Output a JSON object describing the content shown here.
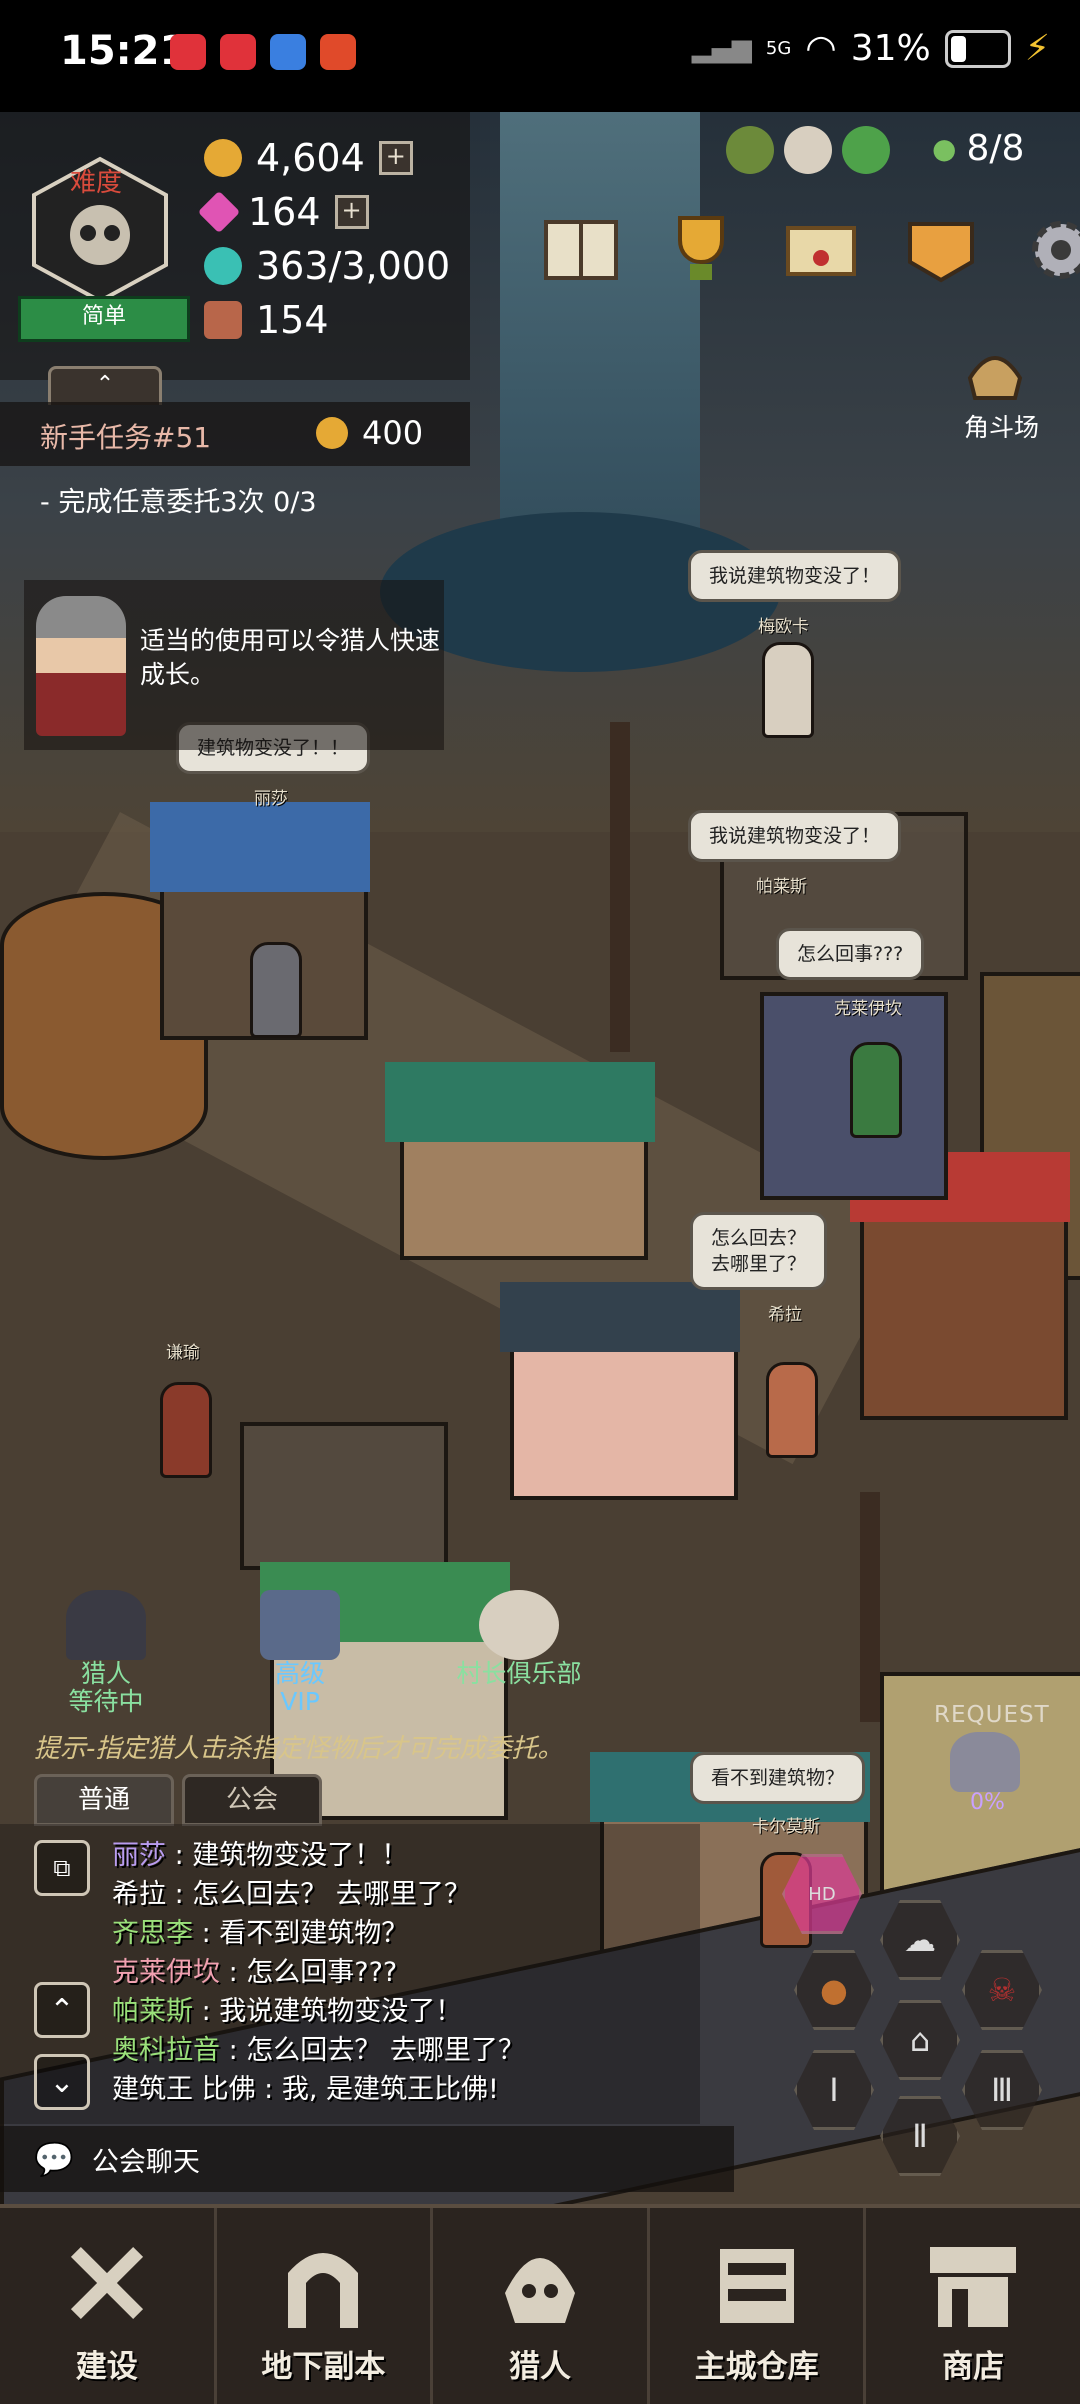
{
  "status_bar": {
    "time": "15:21",
    "network": "5G",
    "battery": "31%",
    "battery_level": 0.31
  },
  "hud": {
    "difficulty_label": "难度",
    "difficulty_value": "简单",
    "gold": "4,604",
    "gems": "164",
    "crystal": "363/3,000",
    "chests": "154",
    "population": "8/8",
    "arena_label": "角斗场",
    "icons": [
      "gift-icon",
      "hunter-face-icon",
      "potion-bag-icon"
    ],
    "menu_icons": [
      "book-icon",
      "trophy-icon",
      "letter-icon",
      "guild-flag-icon",
      "gear-icon"
    ]
  },
  "quest": {
    "title": "新手任务#51",
    "reward": "400",
    "task": "- 完成任意委托3次 0/3"
  },
  "tip": {
    "text": "适当的使用可以令猎人快速成长。"
  },
  "world": {
    "bubbles": [
      {
        "name": "梅欧卡",
        "text": "我说建筑物变没了！"
      },
      {
        "name": "丽莎",
        "text": "建筑物变没了！！"
      },
      {
        "name": "帕莱斯",
        "text": "我说建筑物变没了！"
      },
      {
        "name": "克莱伊坎",
        "text": "怎么回事???"
      },
      {
        "name": "希拉",
        "text": "怎么回去？\n去哪里了？"
      },
      {
        "name": "卡尔莫斯",
        "text": "看不到建筑物？"
      }
    ],
    "idle_name": "谦瑜"
  },
  "hunter_buttons": [
    {
      "label": "猎人\n等待中"
    },
    {
      "label": "高级\nVIP"
    },
    {
      "label": "村长俱乐部"
    }
  ],
  "hint": "提示-指定猎人击杀指定怪物后才可完成委托。",
  "request": {
    "label": "REQUEST",
    "percent": "0%"
  },
  "chat": {
    "tabs": [
      "普通",
      "公会"
    ],
    "active_tab": 0,
    "lines": [
      {
        "name": "丽莎",
        "msg": "建筑物变没了！！",
        "color": "#b99cf0"
      },
      {
        "name": "希拉",
        "msg": "怎么回去？ 去哪里了？",
        "color": "#ffffff"
      },
      {
        "name": "齐思李",
        "msg": "看不到建筑物？",
        "color": "#9ae07a"
      },
      {
        "name": "克莱伊坎",
        "msg": "怎么回事???",
        "color": "#f0a0b0"
      },
      {
        "name": "帕莱斯",
        "msg": "我说建筑物变没了！",
        "color": "#9ae07a"
      },
      {
        "name": "奥科拉音",
        "msg": "怎么回去？ 去哪里了？",
        "color": "#9ae07a"
      },
      {
        "name": "建筑王 比佛",
        "msg": "我, 是建筑王比佛!",
        "color": "#ffffff"
      }
    ],
    "guild_chat_label": "公会聊天"
  },
  "hex_buttons": [
    "Ⅰ",
    "Ⅱ",
    "Ⅲ"
  ],
  "bottom_nav": [
    {
      "label": "建设",
      "icon": "hammer-wrench-icon"
    },
    {
      "label": "地下副本",
      "icon": "dungeon-gate-icon"
    },
    {
      "label": "猎人",
      "icon": "hunter-helmet-icon"
    },
    {
      "label": "主城仓库",
      "icon": "warehouse-chest-icon"
    },
    {
      "label": "商店",
      "icon": "shop-icon"
    }
  ],
  "colors": {
    "accent_gold": "#e5a935",
    "difficulty_green": "#2c8d46",
    "nav_bg": "#2b241f"
  }
}
